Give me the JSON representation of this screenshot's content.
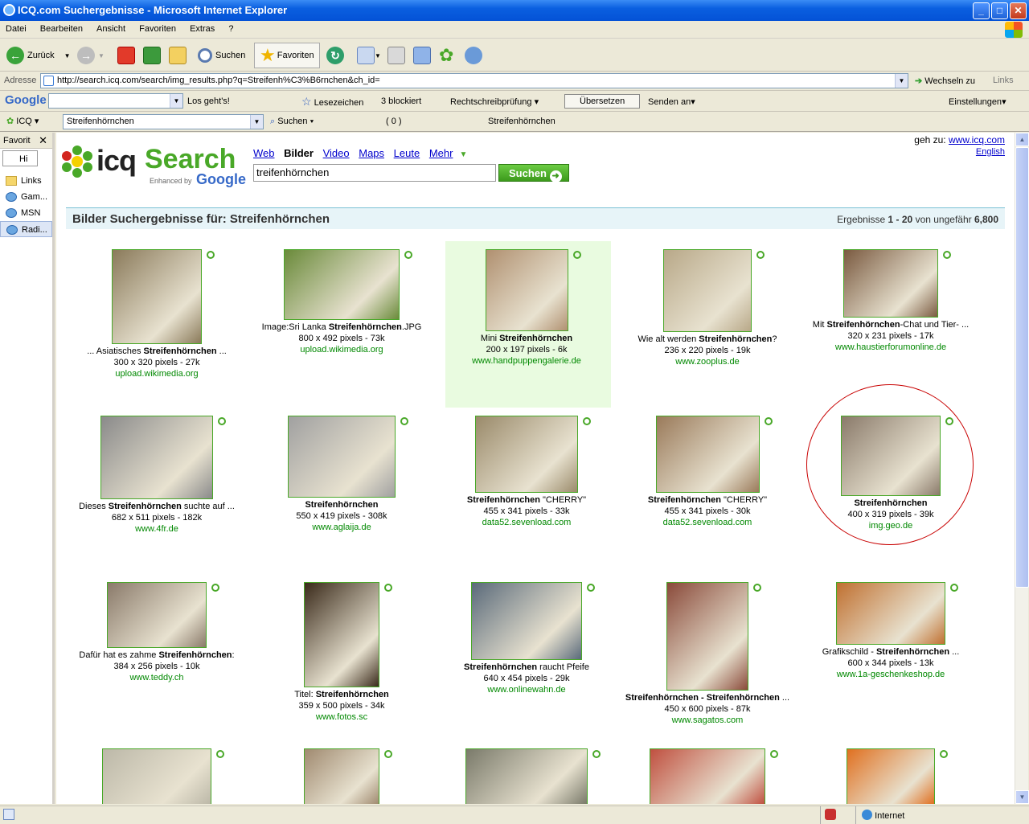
{
  "window": {
    "title": "ICQ.com Suchergebnisse - Microsoft Internet Explorer",
    "min": "_",
    "max": "□",
    "close": "✕"
  },
  "menu": [
    "Datei",
    "Bearbeiten",
    "Ansicht",
    "Favoriten",
    "Extras",
    "?"
  ],
  "toolbar": {
    "back": "Zurück",
    "search": "Suchen",
    "favorites": "Favoriten"
  },
  "address": {
    "label": "Adresse",
    "url": "http://search.icq.com/search/img_results.php?q=Streifenh%C3%B6rnchen&ch_id=",
    "go": "Wechseln zu",
    "links": "Links"
  },
  "googlebar": {
    "logo": "Google",
    "go": "Los geht's!",
    "bookmarks": "Lesezeichen",
    "blocked": "3 blockiert",
    "spell": "Rechtschreibprüfung",
    "translate": "Übersetzen",
    "send": "Senden an",
    "settings": "Einstellungen"
  },
  "icqbar": {
    "label": "ICQ",
    "query": "Streifenhörnchen",
    "search": "Suchen",
    "count": "( 0 )",
    "tab": "Streifenhörnchen"
  },
  "sidebar": {
    "title": "Favorit",
    "hist": "Hi",
    "items": [
      "Links",
      "Gam...",
      "MSN",
      "Radi..."
    ]
  },
  "page": {
    "goto_label": "geh zu:",
    "goto_link": "www.icq.com",
    "english": "English",
    "nav": [
      "Web",
      "Bilder",
      "Video",
      "Maps",
      "Leute",
      "Mehr"
    ],
    "query": "treifenhörnchen",
    "search_btn": "Suchen",
    "logo_icq": "icq",
    "logo_search": "Search",
    "logo_enh": "Enhanced by",
    "logo_google": "Google",
    "results_title": "Bilder Suchergebnisse für: Streifenhörnchen",
    "results_pre": "Ergebnisse",
    "results_range": "1 - 20",
    "results_mid": "von ungefähr",
    "results_total": "6,800"
  },
  "results": [
    {
      "pre": "... Asiatisches ",
      "bold": "Streifenhörnchen",
      "post": " ...",
      "size": "300 x 320 pixels - 27k",
      "url": "upload.wikimedia.org"
    },
    {
      "pre": "Image:Sri Lanka ",
      "bold": "Streifenhörnchen",
      "post": ".JPG",
      "size": "800 x 492 pixels - 73k",
      "url": "upload.wikimedia.org"
    },
    {
      "pre": "Mini ",
      "bold": "Streifenhörnchen",
      "post": "",
      "size": "200 x 197 pixels - 6k",
      "url": "www.handpuppengalerie.de"
    },
    {
      "pre": "Wie alt werden ",
      "bold": "Streifenhörnchen",
      "post": "?",
      "size": "236 x 220 pixels - 19k",
      "url": "www.zooplus.de"
    },
    {
      "pre": "Mit ",
      "bold": "Streifenhörnchen",
      "post": "-Chat und Tier- ...",
      "size": "320 x 231 pixels - 17k",
      "url": "www.haustierforumonline.de"
    },
    {
      "pre": "Dieses ",
      "bold": "Streifenhörnchen",
      "post": " suchte auf ...",
      "size": "682 x 511 pixels - 182k",
      "url": "www.4fr.de"
    },
    {
      "pre": "",
      "bold": "Streifenhörnchen",
      "post": "",
      "size": "550 x 419 pixels - 308k",
      "url": "www.aglaija.de"
    },
    {
      "pre": "",
      "bold": "Streifenhörnchen",
      "post": " \"CHERRY\"",
      "size": "455 x 341 pixels - 33k",
      "url": "data52.sevenload.com"
    },
    {
      "pre": "",
      "bold": "Streifenhörnchen",
      "post": " \"CHERRY\"",
      "size": "455 x 341 pixels - 30k",
      "url": "data52.sevenload.com"
    },
    {
      "pre": "",
      "bold": "Streifenhörnchen",
      "post": "",
      "size": "400 x 319 pixels - 39k",
      "url": "img.geo.de"
    },
    {
      "pre": "Dafür hat es zahme ",
      "bold": "Streifenhörnchen",
      "post": ":",
      "size": "384 x 256 pixels - 10k",
      "url": "www.teddy.ch"
    },
    {
      "pre": "Titel: ",
      "bold": "Streifenhörnchen",
      "post": "",
      "size": "359 x 500 pixels - 34k",
      "url": "www.fotos.sc"
    },
    {
      "pre": "",
      "bold": "Streifenhörnchen",
      "post": " raucht Pfeife",
      "size": "640 x 454 pixels - 29k",
      "url": "www.onlinewahn.de"
    },
    {
      "pre": "",
      "bold": "Streifenhörnchen - Streifenhörnchen",
      "post": " ...",
      "size": "450 x 600 pixels - 87k",
      "url": "www.sagatos.com"
    },
    {
      "pre": "Grafikschild - ",
      "bold": "Streifenhörnchen",
      "post": " ...",
      "size": "600 x 344 pixels - 13k",
      "url": "www.1a-geschenkeshop.de"
    },
    {
      "pre": "",
      "bold": "",
      "post": "",
      "size": "",
      "url": ""
    },
    {
      "pre": "",
      "bold": "",
      "post": "",
      "size": "",
      "url": ""
    },
    {
      "pre": "",
      "bold": "",
      "post": "",
      "size": "",
      "url": ""
    },
    {
      "pre": "",
      "bold": "",
      "post": "",
      "size": "",
      "url": ""
    },
    {
      "pre": "",
      "bold": "",
      "post": "",
      "size": "",
      "url": ""
    }
  ],
  "status": {
    "zone": "Internet"
  },
  "colors": {
    "accent": "#49a828",
    "link": "#0000cc",
    "url": "#008800",
    "xp_blue": "#0a5fe0"
  }
}
